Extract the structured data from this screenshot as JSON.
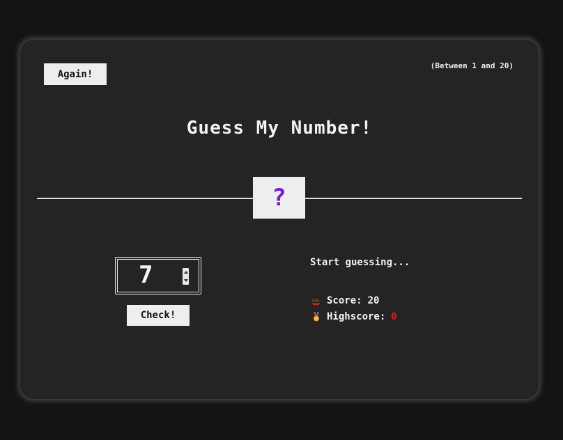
{
  "header": {
    "again_label": "Again!",
    "between_text": "(Between 1 and 20)"
  },
  "title": "Guess My Number!",
  "secret": {
    "display": "?",
    "color": "#7a18d8"
  },
  "guess": {
    "value": "7"
  },
  "check_label": "Check!",
  "message": "Start guessing...",
  "score": {
    "icon": "hundred-points-icon",
    "label": "Score:",
    "value": "20"
  },
  "highscore": {
    "icon": "medal-icon",
    "label": "Highscore:",
    "value": "0",
    "value_color": "#e01b1b"
  },
  "colors": {
    "background": "#131313",
    "card": "#242424",
    "button": "#eeeeee",
    "accent": "#7a18d8"
  }
}
